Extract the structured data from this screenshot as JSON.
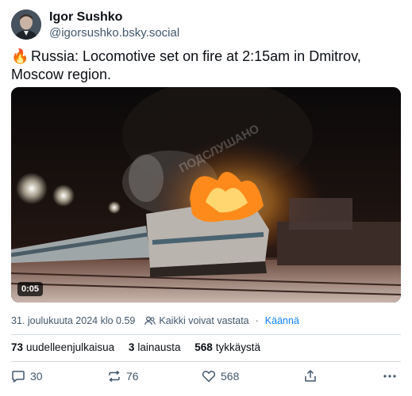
{
  "author": {
    "name": "Igor Sushko",
    "handle": "@igorsushko.bsky.social"
  },
  "post": {
    "emoji": "🔥",
    "text": "Russia: Locomotive set on fire at 2:15am in Dmitrov, Moscow region."
  },
  "media": {
    "duration": "0:05",
    "watermark": "ПОДСЛУШАНО"
  },
  "meta": {
    "timestamp": "31. joulukuuta 2024 klo 0.59",
    "reply_setting": "Kaikki voivat vastata",
    "separator": "·",
    "translate_label": "Käännä"
  },
  "stats": {
    "reposts_count": "73",
    "reposts_label": "uudelleenjulkaisua",
    "quotes_count": "3",
    "quotes_label": "lainausta",
    "likes_count": "568",
    "likes_label": "tykkäystä"
  },
  "actions": {
    "reply_count": "30",
    "repost_count": "76",
    "like_count": "568"
  },
  "colors": {
    "accent": "#1083fe",
    "muted": "#42576c"
  }
}
